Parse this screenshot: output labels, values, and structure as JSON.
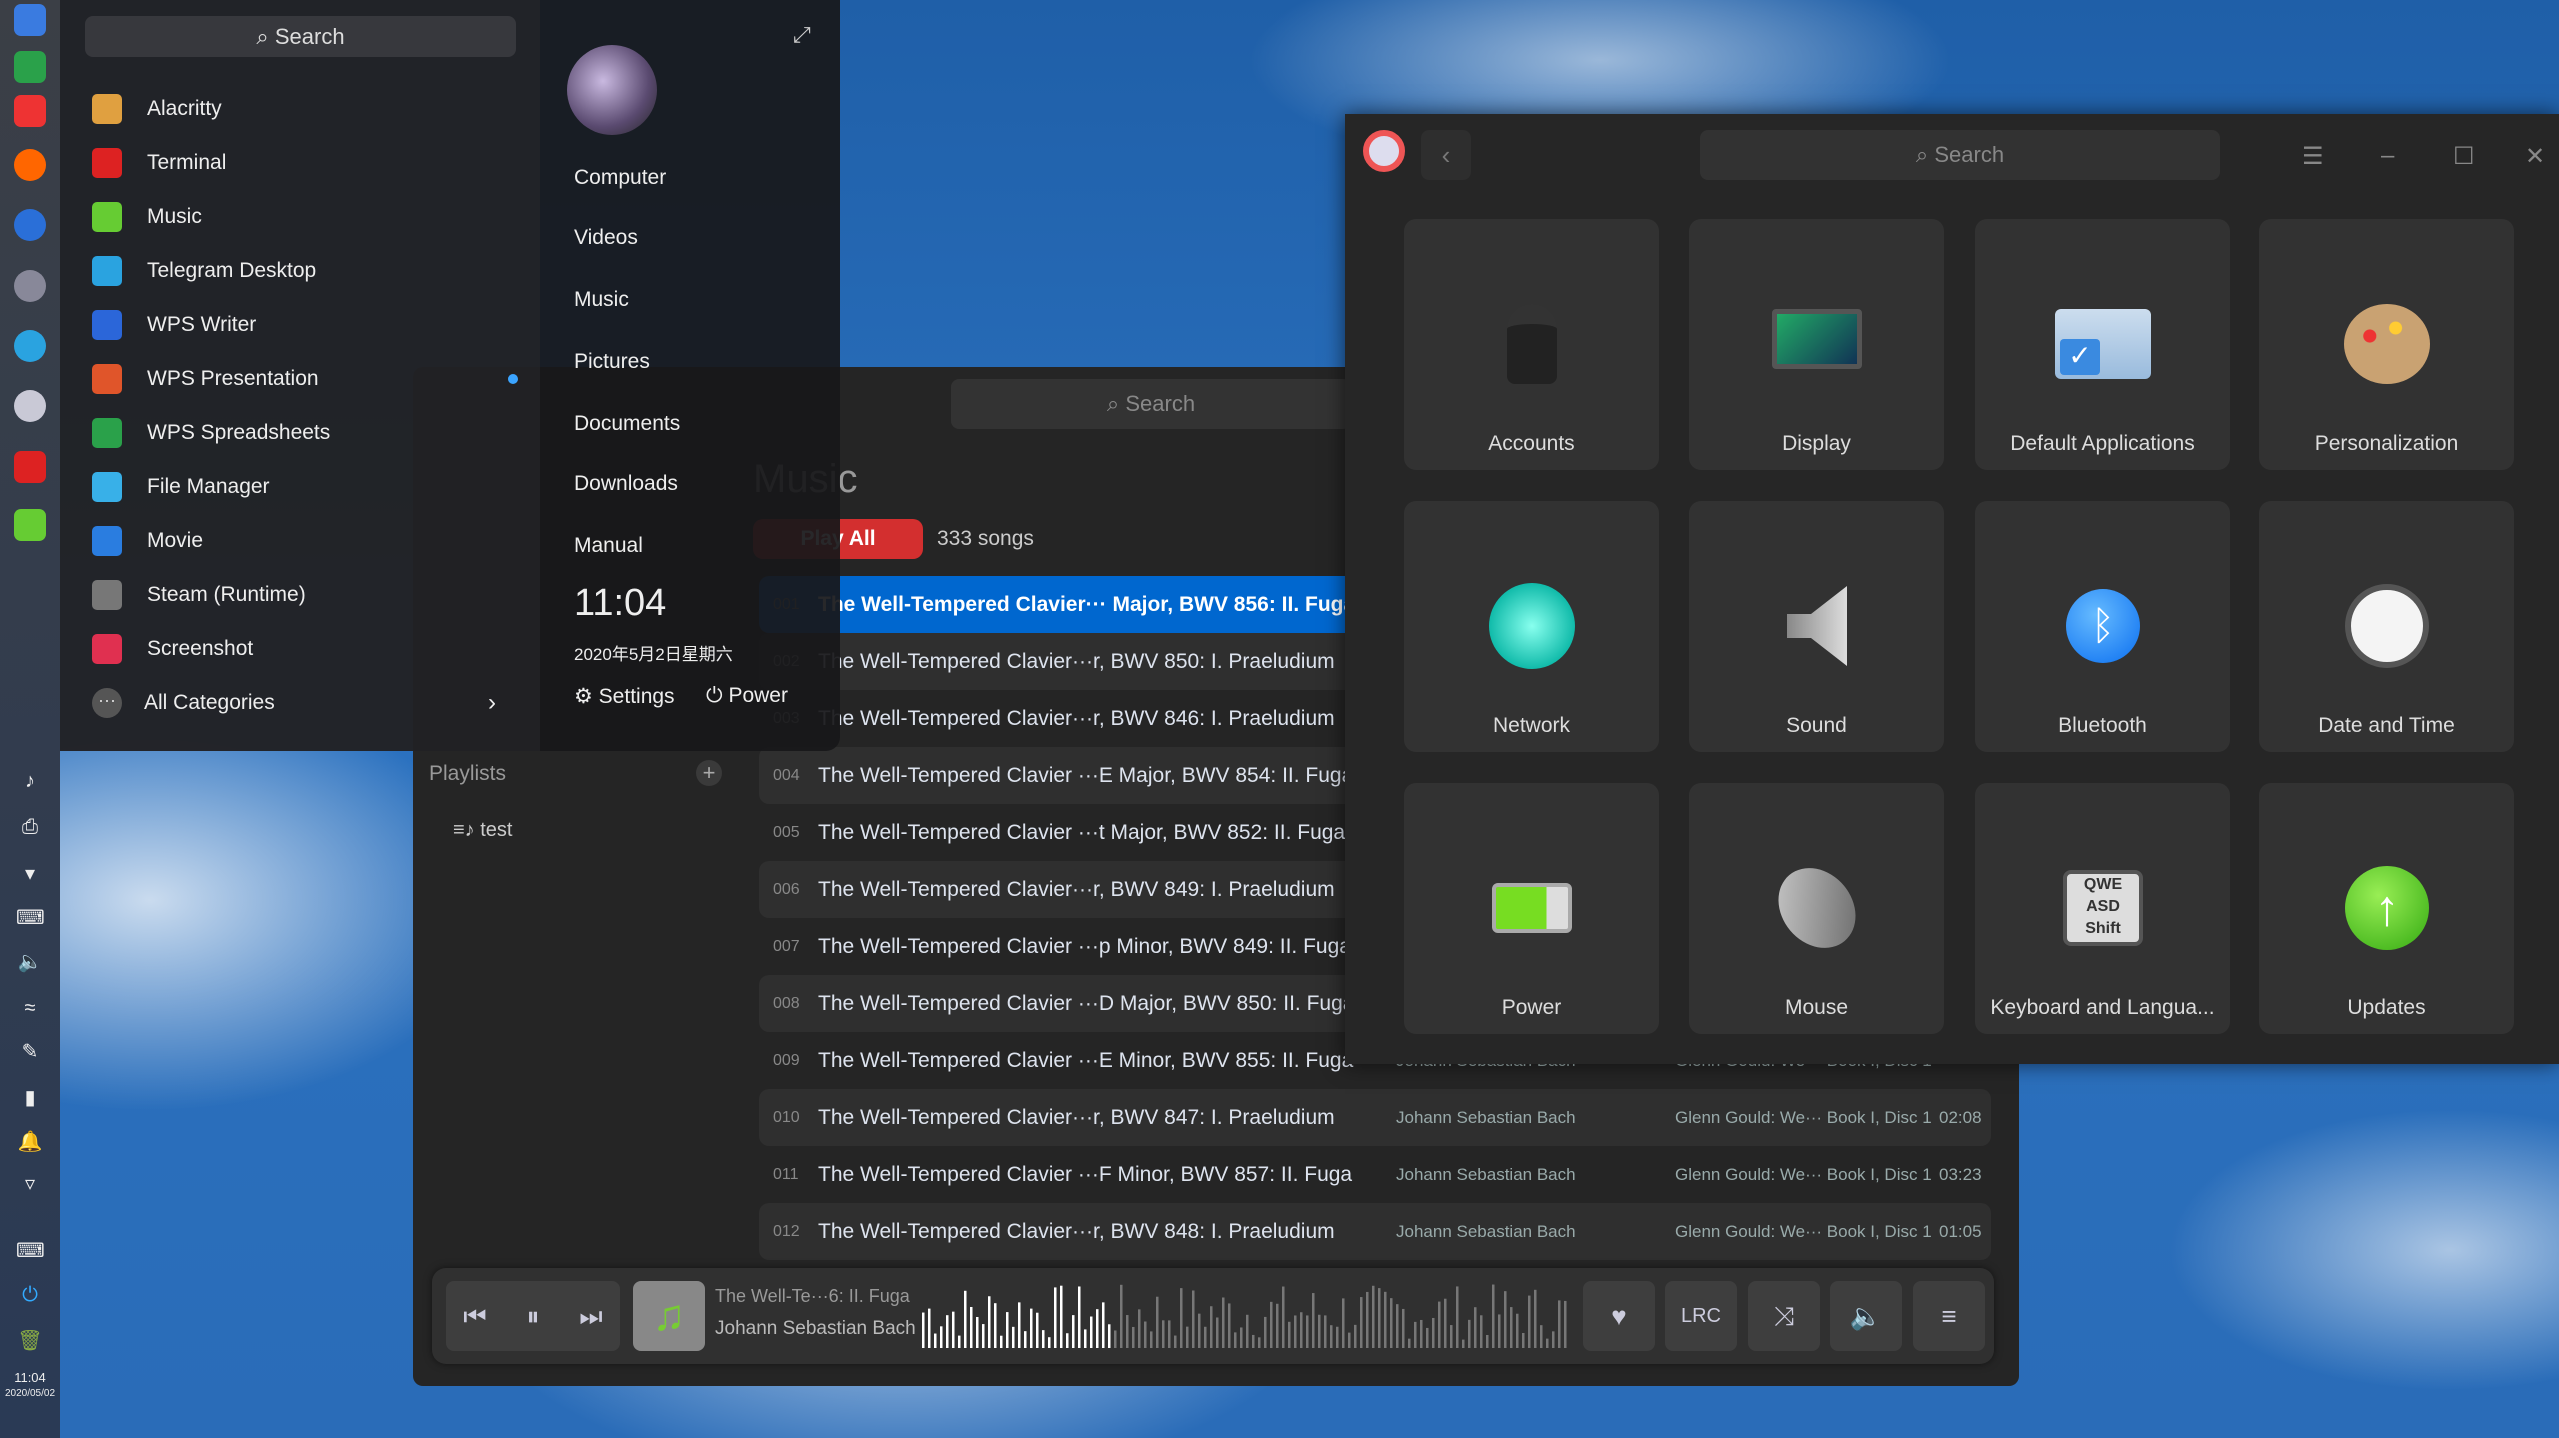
{
  "dock": {
    "apps": [
      "deepin-icon",
      "spreadsheet-icon",
      "screen-recorder-icon",
      "firefox-icon",
      "thunderbird-icon",
      "steam-icon",
      "telegram-icon",
      "settings-icon",
      "terminal-icon",
      "music-icon"
    ],
    "tray": [
      "music-player-icon",
      "printer-icon",
      "wifi-signal-icon",
      "keyboard-layout-icon",
      "volume-icon",
      "wifi-icon",
      "pen-icon",
      "battery-charging-icon",
      "notification-bell-icon",
      "expand-arrow-icon"
    ],
    "time": "11:04",
    "date": "2020/05/02"
  },
  "launcher": {
    "search_placeholder": "Search",
    "apps": [
      {
        "label": "Alacritty",
        "color": "#e0a040"
      },
      {
        "label": "Terminal",
        "color": "#d22"
      },
      {
        "label": "Music",
        "color": "#6c3"
      },
      {
        "label": "Telegram Desktop",
        "color": "#2aa3e0"
      },
      {
        "label": "WPS Writer",
        "color": "#2b66d9"
      },
      {
        "label": "WPS Presentation",
        "color": "#e0552a"
      },
      {
        "label": "WPS Spreadsheets",
        "color": "#2aa14a"
      },
      {
        "label": "File Manager",
        "color": "#38b0e8"
      },
      {
        "label": "Movie",
        "color": "#2a7de0"
      },
      {
        "label": "Steam (Runtime)",
        "color": "#777"
      },
      {
        "label": "Screenshot",
        "color": "#e03050"
      }
    ],
    "all_categories": "All Categories",
    "places": [
      "Computer",
      "Videos",
      "Music",
      "Pictures",
      "Documents",
      "Downloads",
      "Manual"
    ],
    "time": "11:04",
    "date": "2020年5月2日星期六",
    "settings": "Settings",
    "power": "Power"
  },
  "music": {
    "search_placeholder": "Search",
    "title": "Music",
    "play_all": "Play All",
    "count": "333 songs",
    "playlists_label": "Playlists",
    "playlists": [
      "test"
    ],
    "songs": [
      {
        "n": "001",
        "t": "The Well-Tempered Clavier··· Major, BWV 856: II. Fuga",
        "a": "",
        "al": "",
        "d": ""
      },
      {
        "n": "002",
        "t": "The Well-Tempered Clavier···r, BWV 850: I. Praeludium",
        "a": "",
        "al": "",
        "d": ""
      },
      {
        "n": "003",
        "t": "The Well-Tempered Clavier···r, BWV 846: I. Praeludium",
        "a": "",
        "al": "",
        "d": ""
      },
      {
        "n": "004",
        "t": "The Well-Tempered Clavier ···E Major, BWV 854: II. Fuga",
        "a": "",
        "al": "",
        "d": ""
      },
      {
        "n": "005",
        "t": "The Well-Tempered Clavier ···t Major, BWV 852: II. Fuga",
        "a": "",
        "al": "",
        "d": ""
      },
      {
        "n": "006",
        "t": "The Well-Tempered Clavier···r, BWV 849: I. Praeludium",
        "a": "",
        "al": "",
        "d": ""
      },
      {
        "n": "007",
        "t": "The Well-Tempered Clavier ···p Minor, BWV 849: II. Fuga",
        "a": "",
        "al": "",
        "d": ""
      },
      {
        "n": "008",
        "t": "The Well-Tempered Clavier ···D Major, BWV 850: II. Fuga",
        "a": "",
        "al": "",
        "d": ""
      },
      {
        "n": "009",
        "t": "The Well-Tempered Clavier ···E Minor, BWV 855: II. Fuga",
        "a": "Johann Sebastian Bach",
        "al": "Glenn Gould: We··· Book I, Disc 1",
        "d": ""
      },
      {
        "n": "010",
        "t": "The Well-Tempered Clavier···r, BWV 847: I. Praeludium",
        "a": "Johann Sebastian Bach",
        "al": "Glenn Gould: We··· Book I, Disc 1",
        "d": "02:08"
      },
      {
        "n": "011",
        "t": "The Well-Tempered Clavier ···F Minor, BWV 857: II. Fuga",
        "a": "Johann Sebastian Bach",
        "al": "Glenn Gould: We··· Book I, Disc 1",
        "d": "03:23"
      },
      {
        "n": "012",
        "t": "The Well-Tempered Clavier···r, BWV 848: I. Praeludium",
        "a": "Johann Sebastian Bach",
        "al": "Glenn Gould: We··· Book I, Disc 1",
        "d": "01:05"
      }
    ],
    "player": {
      "title": "The Well-Te···6: II. Fuga",
      "artist": "Johann Sebastian Bach",
      "progress": 0.29,
      "lrc": "LRC"
    }
  },
  "settings": {
    "search_placeholder": "Search",
    "tiles": [
      {
        "label": "Accounts",
        "icon": "accounts-icon"
      },
      {
        "label": "Display",
        "icon": "display-icon"
      },
      {
        "label": "Default Applications",
        "icon": "default-applications-icon"
      },
      {
        "label": "Personalization",
        "icon": "personalization-icon"
      },
      {
        "label": "Network",
        "icon": "network-icon"
      },
      {
        "label": "Sound",
        "icon": "sound-icon"
      },
      {
        "label": "Bluetooth",
        "icon": "bluetooth-icon"
      },
      {
        "label": "Date and Time",
        "icon": "clock-icon"
      },
      {
        "label": "Power",
        "icon": "battery-icon"
      },
      {
        "label": "Mouse",
        "icon": "mouse-icon"
      },
      {
        "label": "Keyboard and Langua...",
        "icon": "keyboard-icon"
      },
      {
        "label": "Updates",
        "icon": "updates-icon"
      }
    ]
  },
  "colors": {
    "accent": "#0067cf",
    "play_all": "#d32f2f"
  }
}
